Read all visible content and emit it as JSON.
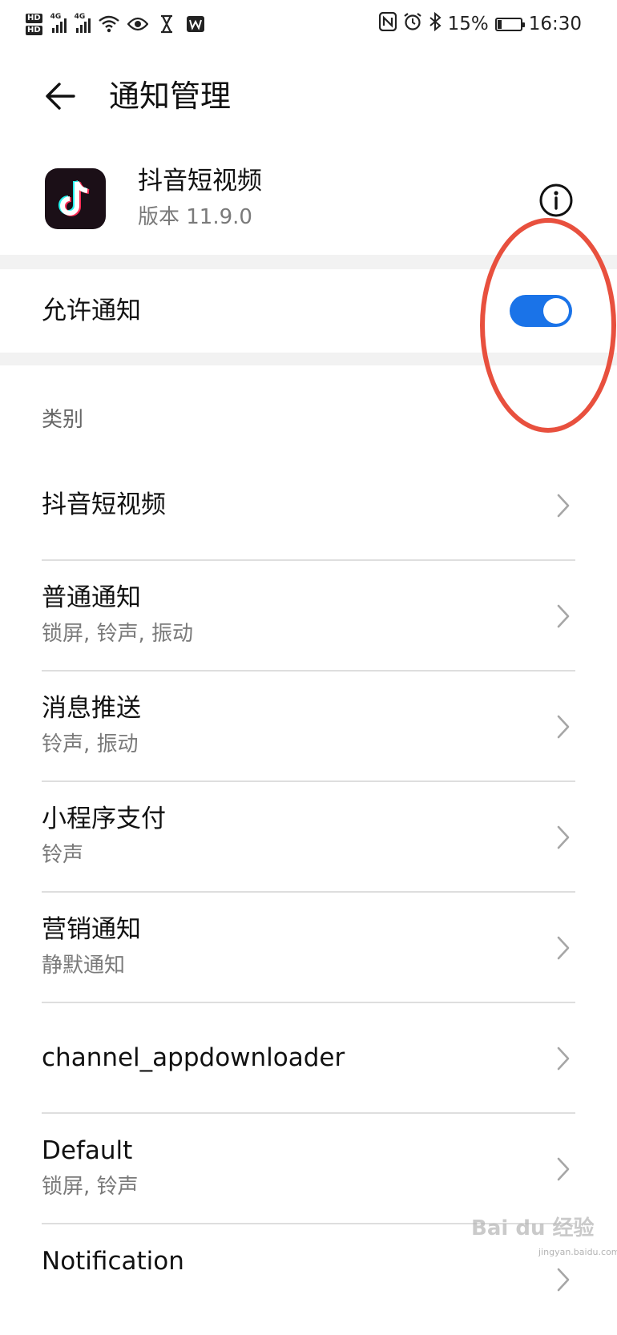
{
  "status_bar": {
    "hd1": "HD",
    "hd2": "HD",
    "net1": "4G",
    "net2": "4G",
    "battery": "15%",
    "time": "16:30"
  },
  "header": {
    "title": "通知管理"
  },
  "app": {
    "name": "抖音短视频",
    "version": "版本 11.9.0"
  },
  "allow": {
    "label": "允许通知",
    "enabled": true
  },
  "section": {
    "title": "类别"
  },
  "items": [
    {
      "title": "抖音短视频",
      "subtitle": ""
    },
    {
      "title": "普通通知",
      "subtitle": "锁屏, 铃声, 振动"
    },
    {
      "title": "消息推送",
      "subtitle": "铃声, 振动"
    },
    {
      "title": "小程序支付",
      "subtitle": "铃声"
    },
    {
      "title": "营销通知",
      "subtitle": "静默通知"
    },
    {
      "title": "channel_appdownloader",
      "subtitle": ""
    },
    {
      "title": "Default",
      "subtitle": "锁屏, 铃声"
    },
    {
      "title": "Notification",
      "subtitle": ""
    }
  ],
  "watermark": {
    "text": "Bai du 经验",
    "url": "jingyan.baidu.com"
  },
  "colors": {
    "accent": "#1a73e8",
    "annotation": "#e8503e",
    "app_icon_bg": "#1b0f17"
  }
}
